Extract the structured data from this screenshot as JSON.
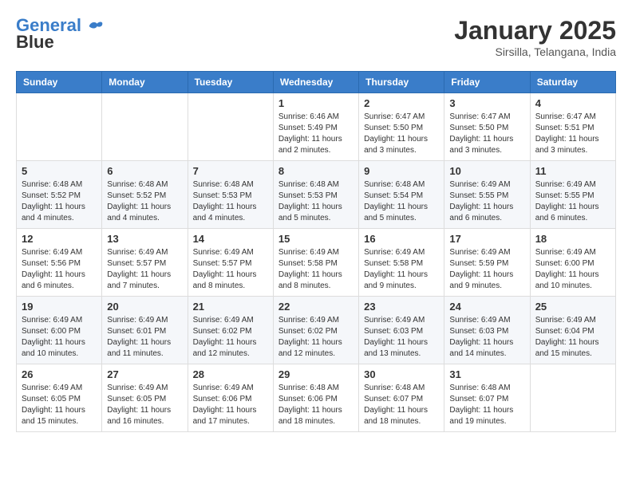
{
  "header": {
    "logo_line1": "General",
    "logo_line2": "Blue",
    "month_title": "January 2025",
    "subtitle": "Sirsilla, Telangana, India"
  },
  "days_of_week": [
    "Sunday",
    "Monday",
    "Tuesday",
    "Wednesday",
    "Thursday",
    "Friday",
    "Saturday"
  ],
  "weeks": [
    [
      {
        "day": "",
        "info": ""
      },
      {
        "day": "",
        "info": ""
      },
      {
        "day": "",
        "info": ""
      },
      {
        "day": "1",
        "info": "Sunrise: 6:46 AM\nSunset: 5:49 PM\nDaylight: 11 hours\nand 2 minutes."
      },
      {
        "day": "2",
        "info": "Sunrise: 6:47 AM\nSunset: 5:50 PM\nDaylight: 11 hours\nand 3 minutes."
      },
      {
        "day": "3",
        "info": "Sunrise: 6:47 AM\nSunset: 5:50 PM\nDaylight: 11 hours\nand 3 minutes."
      },
      {
        "day": "4",
        "info": "Sunrise: 6:47 AM\nSunset: 5:51 PM\nDaylight: 11 hours\nand 3 minutes."
      }
    ],
    [
      {
        "day": "5",
        "info": "Sunrise: 6:48 AM\nSunset: 5:52 PM\nDaylight: 11 hours\nand 4 minutes."
      },
      {
        "day": "6",
        "info": "Sunrise: 6:48 AM\nSunset: 5:52 PM\nDaylight: 11 hours\nand 4 minutes."
      },
      {
        "day": "7",
        "info": "Sunrise: 6:48 AM\nSunset: 5:53 PM\nDaylight: 11 hours\nand 4 minutes."
      },
      {
        "day": "8",
        "info": "Sunrise: 6:48 AM\nSunset: 5:53 PM\nDaylight: 11 hours\nand 5 minutes."
      },
      {
        "day": "9",
        "info": "Sunrise: 6:48 AM\nSunset: 5:54 PM\nDaylight: 11 hours\nand 5 minutes."
      },
      {
        "day": "10",
        "info": "Sunrise: 6:49 AM\nSunset: 5:55 PM\nDaylight: 11 hours\nand 6 minutes."
      },
      {
        "day": "11",
        "info": "Sunrise: 6:49 AM\nSunset: 5:55 PM\nDaylight: 11 hours\nand 6 minutes."
      }
    ],
    [
      {
        "day": "12",
        "info": "Sunrise: 6:49 AM\nSunset: 5:56 PM\nDaylight: 11 hours\nand 6 minutes."
      },
      {
        "day": "13",
        "info": "Sunrise: 6:49 AM\nSunset: 5:57 PM\nDaylight: 11 hours\nand 7 minutes."
      },
      {
        "day": "14",
        "info": "Sunrise: 6:49 AM\nSunset: 5:57 PM\nDaylight: 11 hours\nand 8 minutes."
      },
      {
        "day": "15",
        "info": "Sunrise: 6:49 AM\nSunset: 5:58 PM\nDaylight: 11 hours\nand 8 minutes."
      },
      {
        "day": "16",
        "info": "Sunrise: 6:49 AM\nSunset: 5:58 PM\nDaylight: 11 hours\nand 9 minutes."
      },
      {
        "day": "17",
        "info": "Sunrise: 6:49 AM\nSunset: 5:59 PM\nDaylight: 11 hours\nand 9 minutes."
      },
      {
        "day": "18",
        "info": "Sunrise: 6:49 AM\nSunset: 6:00 PM\nDaylight: 11 hours\nand 10 minutes."
      }
    ],
    [
      {
        "day": "19",
        "info": "Sunrise: 6:49 AM\nSunset: 6:00 PM\nDaylight: 11 hours\nand 10 minutes."
      },
      {
        "day": "20",
        "info": "Sunrise: 6:49 AM\nSunset: 6:01 PM\nDaylight: 11 hours\nand 11 minutes."
      },
      {
        "day": "21",
        "info": "Sunrise: 6:49 AM\nSunset: 6:02 PM\nDaylight: 11 hours\nand 12 minutes."
      },
      {
        "day": "22",
        "info": "Sunrise: 6:49 AM\nSunset: 6:02 PM\nDaylight: 11 hours\nand 12 minutes."
      },
      {
        "day": "23",
        "info": "Sunrise: 6:49 AM\nSunset: 6:03 PM\nDaylight: 11 hours\nand 13 minutes."
      },
      {
        "day": "24",
        "info": "Sunrise: 6:49 AM\nSunset: 6:03 PM\nDaylight: 11 hours\nand 14 minutes."
      },
      {
        "day": "25",
        "info": "Sunrise: 6:49 AM\nSunset: 6:04 PM\nDaylight: 11 hours\nand 15 minutes."
      }
    ],
    [
      {
        "day": "26",
        "info": "Sunrise: 6:49 AM\nSunset: 6:05 PM\nDaylight: 11 hours\nand 15 minutes."
      },
      {
        "day": "27",
        "info": "Sunrise: 6:49 AM\nSunset: 6:05 PM\nDaylight: 11 hours\nand 16 minutes."
      },
      {
        "day": "28",
        "info": "Sunrise: 6:49 AM\nSunset: 6:06 PM\nDaylight: 11 hours\nand 17 minutes."
      },
      {
        "day": "29",
        "info": "Sunrise: 6:48 AM\nSunset: 6:06 PM\nDaylight: 11 hours\nand 18 minutes."
      },
      {
        "day": "30",
        "info": "Sunrise: 6:48 AM\nSunset: 6:07 PM\nDaylight: 11 hours\nand 18 minutes."
      },
      {
        "day": "31",
        "info": "Sunrise: 6:48 AM\nSunset: 6:07 PM\nDaylight: 11 hours\nand 19 minutes."
      },
      {
        "day": "",
        "info": ""
      }
    ]
  ]
}
